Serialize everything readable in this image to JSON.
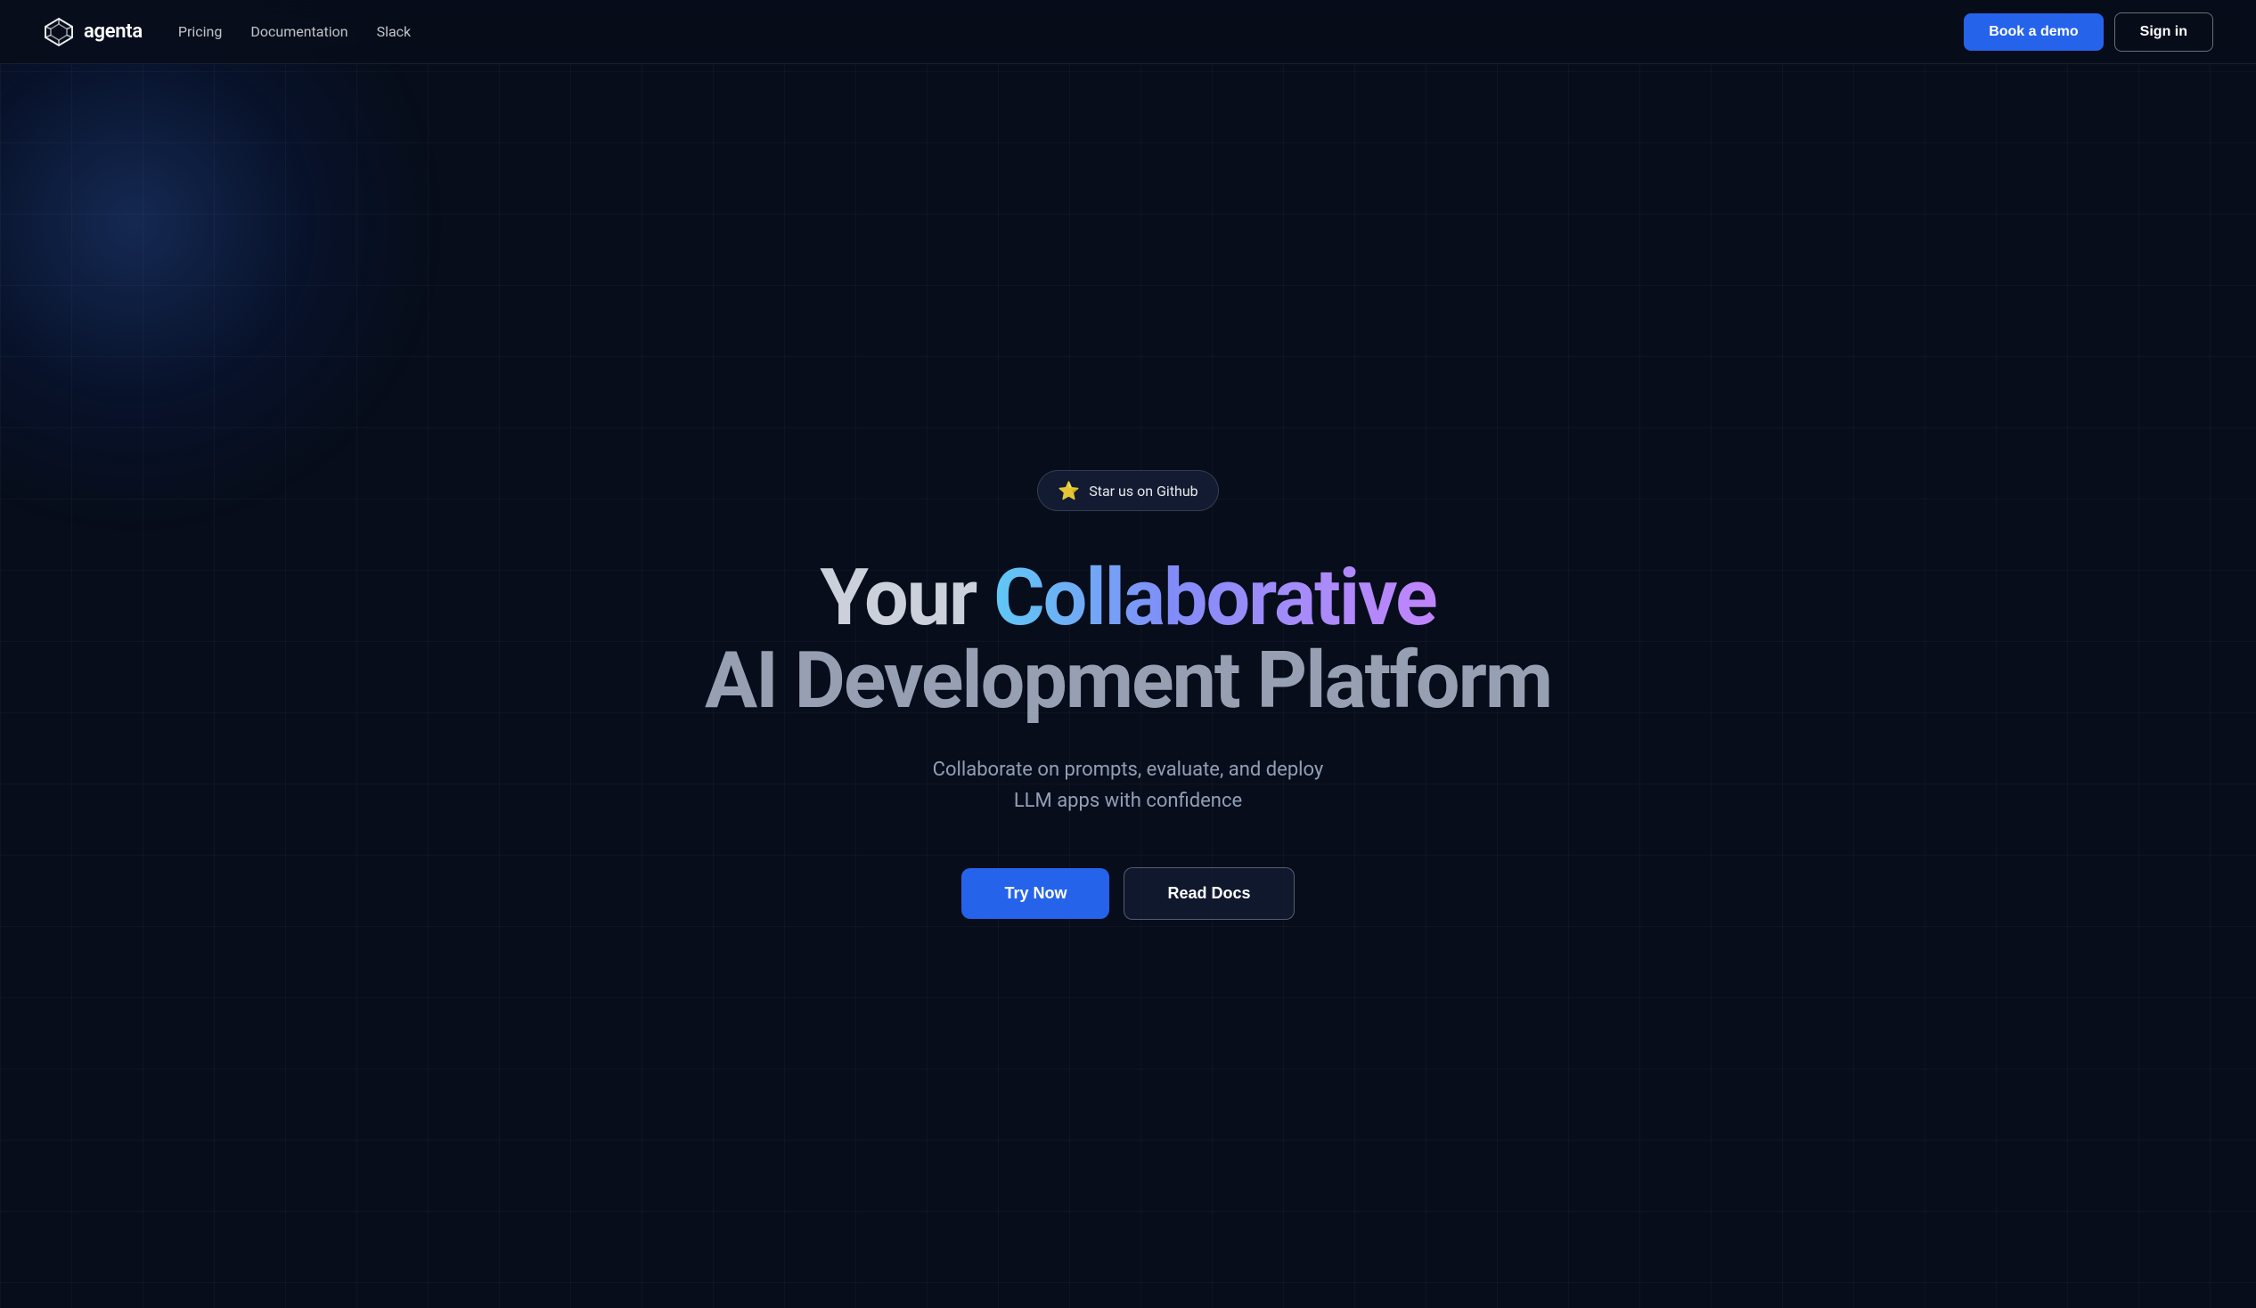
{
  "nav": {
    "logo_text": "agenta",
    "links": [
      {
        "label": "Pricing",
        "id": "pricing-link"
      },
      {
        "label": "Documentation",
        "id": "docs-link"
      },
      {
        "label": "Slack",
        "id": "slack-link"
      }
    ],
    "btn_demo": "Book a demo",
    "btn_signin": "Sign in"
  },
  "hero": {
    "github_badge_label": "Star us on Github",
    "headline_part1": "Your ",
    "headline_collaborative": "Collaborative",
    "headline_part2": "AI Development Platform",
    "subtext_line1": "Collaborate on prompts, evaluate, and deploy",
    "subtext_line2": "LLM apps with confidence",
    "btn_try": "Try Now",
    "btn_docs": "Read Docs"
  }
}
